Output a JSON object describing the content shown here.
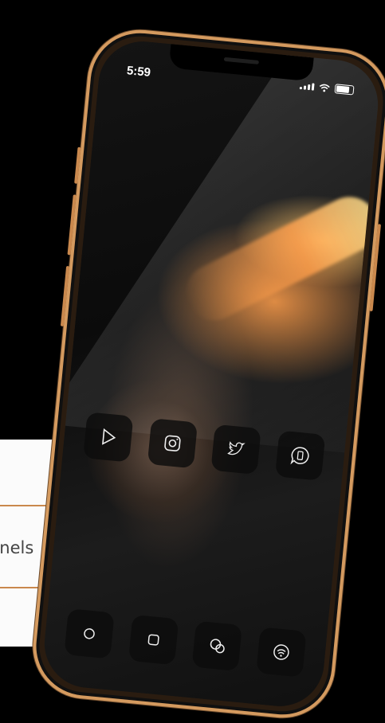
{
  "page": {
    "text_fragment": "nnels"
  },
  "status_bar": {
    "time": "5:59"
  },
  "home_screen": {
    "row1": [
      {
        "icon": "play-icon"
      },
      {
        "icon": "instagram-icon"
      },
      {
        "icon": "twitter-icon"
      },
      {
        "icon": "phone-chat-icon"
      }
    ],
    "dock": [
      {
        "icon": "app-icon"
      },
      {
        "icon": "app-icon"
      },
      {
        "icon": "messages-icon"
      },
      {
        "icon": "podcast-icon"
      }
    ]
  },
  "colors": {
    "accent": "#c9884d",
    "phone_frame": "#d49a5f",
    "icon_bg": "#0c0c0c"
  }
}
